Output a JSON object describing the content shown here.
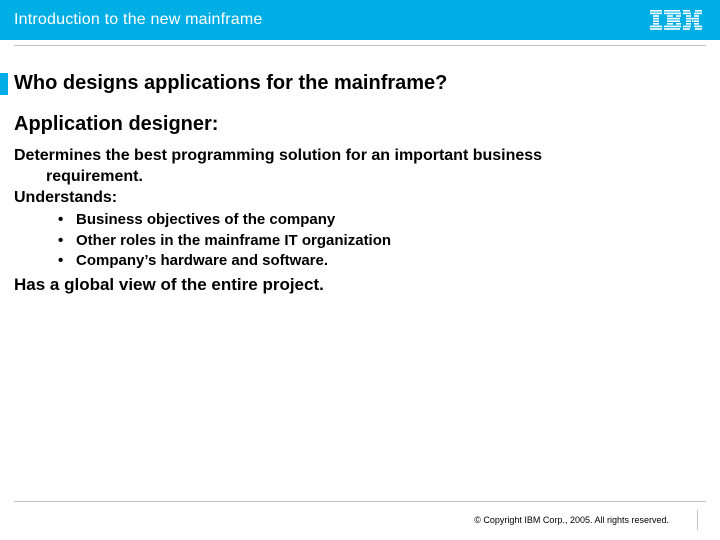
{
  "header": {
    "title": "Introduction to the new mainframe",
    "logo_name": "ibm-logo"
  },
  "title": "Who designs applications for the mainframe?",
  "role_heading": "Application designer:",
  "line1a": "Determines the best programming solution for an important business",
  "line1b": "requirement.",
  "line2": "Understands:",
  "bullets": {
    "b0": "Business objectives of the company",
    "b1": "Other roles in the mainframe IT organization",
    "b2": "Company’s hardware and software."
  },
  "closing": "Has a global view of the entire project.",
  "footer": {
    "copyright": "© Copyright IBM Corp., 2005. All rights reserved."
  }
}
